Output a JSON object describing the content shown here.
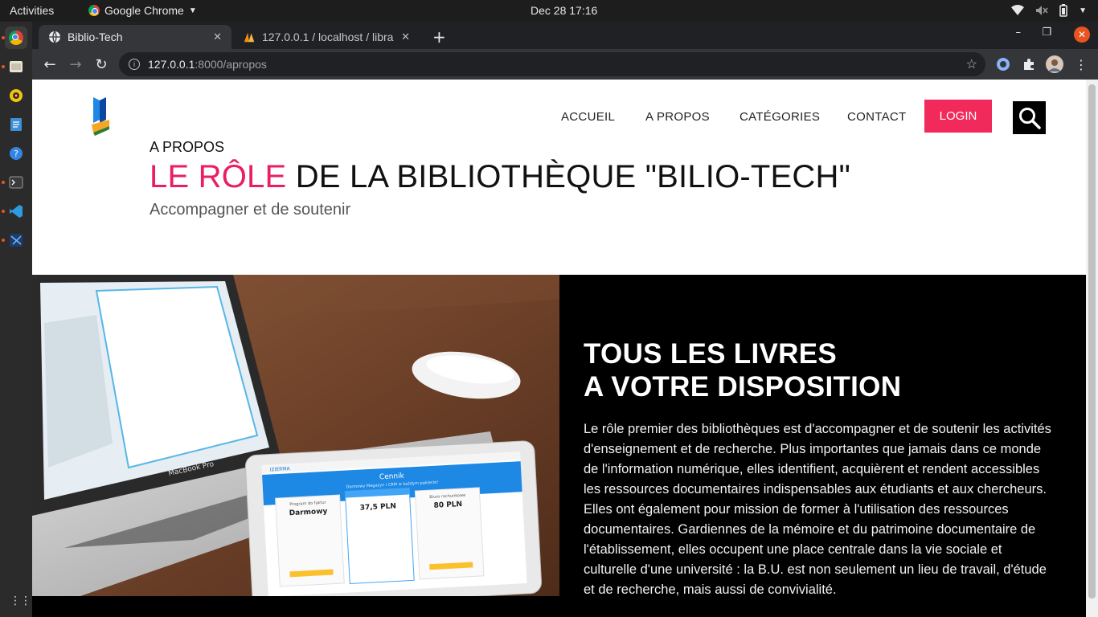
{
  "os": {
    "activities": "Activities",
    "app_name": "Google Chrome",
    "clock": "Dec 28  17:16"
  },
  "browser": {
    "tabs": [
      {
        "title": "Biblio-Tech",
        "active": true
      },
      {
        "title": "127.0.0.1 / localhost / libra",
        "active": false
      }
    ],
    "url_host": "127.0.0.1",
    "url_path": ":8000/apropos"
  },
  "site": {
    "nav": [
      "ACCUEIL",
      "A PROPOS",
      "CATÉGORIES",
      "CONTACT"
    ],
    "login": "LOGIN",
    "colors": {
      "accent": "#f2295b",
      "title_accent": "#e91e63",
      "dark": "#000000"
    }
  },
  "hero": {
    "kicker": "A PROPOS",
    "title_accent": "LE RÔLE",
    "title_rest": " DE LA BIBLIOTHÈQUE \"BILIO-TECH\"",
    "subtitle": "Accompagner et de soutenir"
  },
  "feature": {
    "heading_line1": "TOUS LES LIVRES",
    "heading_line2": "A VOTRE DISPOSITION",
    "body": "Le rôle premier des bibliothèques est d'accompagner et de soutenir les activités d'enseignement et de recherche. Plus importantes que jamais dans ce monde de l'information numérique, elles identifient, acquièrent et rendent accessibles les ressources documentaires indispensables aux étudiants et aux chercheurs. Elles ont également pour mission de former à l'utilisation des ressources documentaires. Gardiennes de la mémoire et du patrimoine documentaire de l'établissement, elles occupent une place centrale dans la vie sociale et culturelle d'une université : la B.U. est non seulement un lieu de travail, d'étude et de recherche, mais aussi de convivialité.",
    "tablet": {
      "brand": "IZIERMA",
      "heading": "Cennik",
      "subheading": "Darmowy Magazyn i CRM w każdym pakiecie!",
      "plans": [
        {
          "name": "Program do faktur",
          "price": "Darmowy"
        },
        {
          "name": "",
          "price": "37,5 PLN"
        },
        {
          "name": "Biuro rachunkowe",
          "price": "80 PLN"
        }
      ],
      "laptop_brand": "MacBook Pro"
    }
  }
}
